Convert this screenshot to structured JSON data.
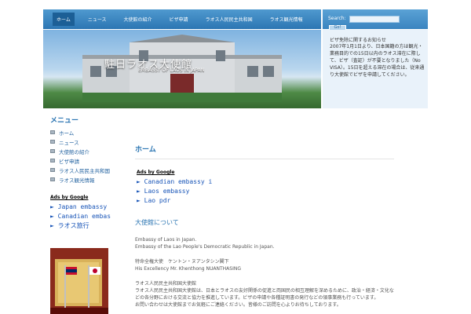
{
  "nav": {
    "items": [
      "ホーム",
      "ニュース",
      "大使館の紹介",
      "ビザ申請",
      "ラオス人民民主共和国",
      "ラオス観光情報"
    ]
  },
  "search": {
    "label": "Search:",
    "button": "Go!"
  },
  "header": {
    "title": "駐日ラオス大使館",
    "subtitle": "EMBASSY OF LAOS IN JAPAN"
  },
  "info": {
    "title": "ビザ免除に関するお知らせ",
    "body": "2007年1月1日より、日本国籍の方は観光・業務目的での15日以内のラオス滞在に際して、ビザ（査証）が不要となりました（No VISA）。15日を超える滞在の場合は、従来通り大使館でビザを申請してください。"
  },
  "sidebar": {
    "heading": "メニュー",
    "items": [
      "ホーム",
      "ニュース",
      "大使館の紹介",
      "ビザ申請",
      "ラオス人民民主共和国",
      "ラオス観光情報"
    ]
  },
  "sideads": {
    "header": "Ads by Google",
    "links": [
      "► Japan embassy",
      "► Canadian embas",
      "► ラオス旅行"
    ]
  },
  "main": {
    "heading": "ホーム",
    "ads_header": "Ads by Google",
    "ads": [
      "► Canadian embassy i",
      "► Laos embassy",
      "► Lao pdr"
    ],
    "section_title": "大使館について",
    "para1_l1": "Embassy of Laos in Japan.",
    "para1_l2": "Embassy of the Lao People's Democratic Republic in Japan.",
    "para2_l1": "特命全権大使　ケントン・ヌアンタシン閣下",
    "para2_l2": "His Excellency Mr. Khenthong NUANTHASING",
    "para3_l1": "ラオス人民民主共和国大使館",
    "para3_l2": "ラオス人民民主共和国大使館は、日本とラオスの友好関係の促進と両国民の相互理解を深めるために、政治・経済・文化などの各分野における交流と協力を推進しています。ビザの申請や各種証明書の発行などの領事業務も行っています。",
    "para3_l3": "お問い合わせは大使館までお気軽にご連絡ください。皆様のご訪問を心よりお待ちしております。"
  }
}
